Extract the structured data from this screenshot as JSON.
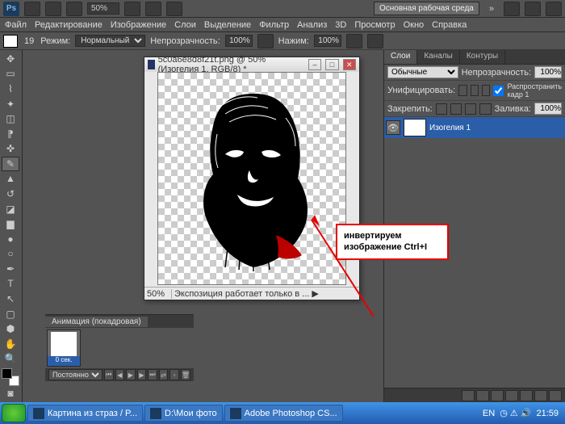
{
  "app": {
    "logo": "Ps",
    "zoom_dropdown": "50%",
    "workspace_button": "Основная рабочая среда"
  },
  "menu": [
    "Файл",
    "Редактирование",
    "Изображение",
    "Слои",
    "Выделение",
    "Фильтр",
    "Анализ",
    "3D",
    "Просмотр",
    "Окно",
    "Справка"
  ],
  "options": {
    "mode_label": "Режим:",
    "mode_value": "Нормальный",
    "opacity_label": "Непрозрачность:",
    "opacity_value": "100%",
    "flow_label": "Нажим:",
    "flow_value": "100%"
  },
  "document": {
    "title": "5c0a6e8d8f21t.png @ 50% (Изогелия 1, RGB/8) *",
    "zoom": "50%",
    "status_msg": "Экспозиция работает только в ...  ▶"
  },
  "annotation": {
    "line1": "инвертируем",
    "line2": "изображение Ctrl+I"
  },
  "layers_panel": {
    "tabs": [
      "Слои",
      "Каналы",
      "Контуры"
    ],
    "blend_mode": "Обычные",
    "opacity_label": "Непрозрачность:",
    "opacity": "100%",
    "fill_label": "Заливка:",
    "fill": "100%",
    "unify_label": "Унифицировать:",
    "propagate_label": "Распространить кадр 1",
    "lock_label": "Закрепить:",
    "layer_name": "Изогелия 1"
  },
  "animation": {
    "title": "Анимация (покадровая)",
    "frame_label": "0 сек.",
    "loop": "Постоянно"
  },
  "taskbar": {
    "items": [
      "Картина из страз / P...",
      "D:\\Мои фото",
      "Adobe Photoshop CS..."
    ],
    "lang": "EN",
    "time": "21:59"
  }
}
